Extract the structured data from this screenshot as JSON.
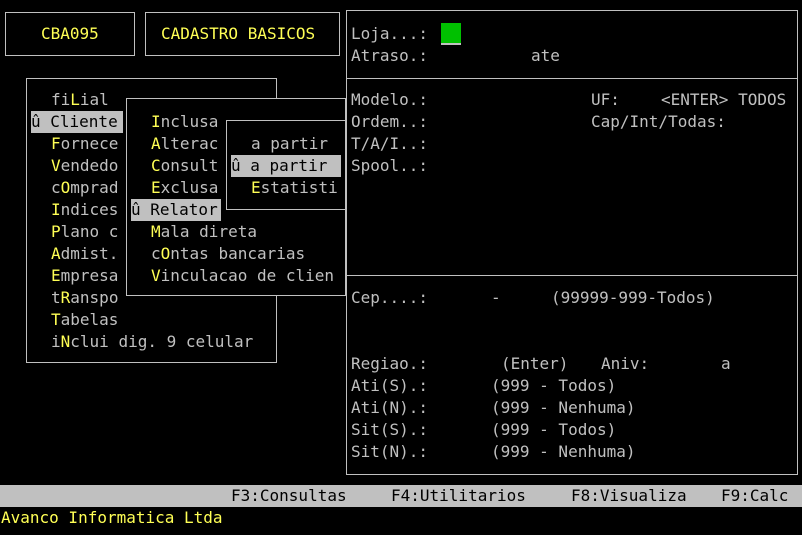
{
  "header": {
    "program_code": "CBA095",
    "title": "CADASTRO BASICOS"
  },
  "main_menu": {
    "items": [
      {
        "hot": "",
        "key": "",
        "rest_pre": "fi",
        "hotkey": "L",
        "rest": "ial",
        "label": "fiLial"
      },
      {
        "label": "û Cliente",
        "selected": true
      },
      {
        "label": "Fornece"
      },
      {
        "label": "Vendedo"
      },
      {
        "label": "cOmprad"
      },
      {
        "label": "Indices"
      },
      {
        "label": "Plano c"
      },
      {
        "label": "Admist."
      },
      {
        "label": "Empresa"
      },
      {
        "label": "tRanspo"
      },
      {
        "label": "Tabelas"
      },
      {
        "label": "iNclui dig. 9 celular"
      }
    ]
  },
  "cliente_submenu": {
    "items": [
      {
        "label": "Inclusa"
      },
      {
        "label": "Alterac"
      },
      {
        "label": "Consult"
      },
      {
        "label": "Exclusa"
      },
      {
        "label": "û Relator",
        "selected": true
      },
      {
        "label": "Mala direta"
      },
      {
        "label": "cOntas bancarias"
      },
      {
        "label": "Vinculacao de clien"
      }
    ]
  },
  "relatorio_submenu": {
    "items": [
      {
        "label": "a partir"
      },
      {
        "label": "û a partir",
        "selected": true
      },
      {
        "label": "Estatisti"
      }
    ]
  },
  "form": {
    "loja_label": "Loja...:",
    "atraso_label": "Atraso.:",
    "atraso_ate": "ate",
    "modelo_label": "Modelo.:",
    "uf_label": "UF:",
    "uf_hint": "<ENTER> TODOS",
    "ordem_label": "Ordem..:",
    "cap_label": "Cap/Int/Todas:",
    "tai_label": "T/A/I..:",
    "spool_label": "Spool..:",
    "cep_label": "Cep....:",
    "cep_dash": "-",
    "cep_hint": "(99999-999-Todos)",
    "regiao_label": "Regiao.:",
    "regiao_hint": "(Enter)",
    "aniv_label": "Aniv:",
    "aniv_a": "a",
    "ati_s_label": "Ati(S).:",
    "ati_s_hint": "(999 - Todos)",
    "ati_n_label": "Ati(N).:",
    "ati_n_hint": "(999 - Nenhuma)",
    "sit_s_label": "Sit(S).:",
    "sit_s_hint": "(999 - Todos)",
    "sit_n_label": "Sit(N).:",
    "sit_n_hint": "(999 - Nenhuma)"
  },
  "function_keys": {
    "f3": "F3:Consultas",
    "f4": "F4:Utilitarios",
    "f8": "F8:Visualiza",
    "f9": "F9:Calc"
  },
  "footer": {
    "company": "Avanco Informatica Ltda"
  },
  "colors": {
    "background": "#000000",
    "text": "#c0c0c0",
    "hotkey": "#ffff55",
    "highlight_bg": "#c0c0c0",
    "cursor": "#00c000"
  }
}
